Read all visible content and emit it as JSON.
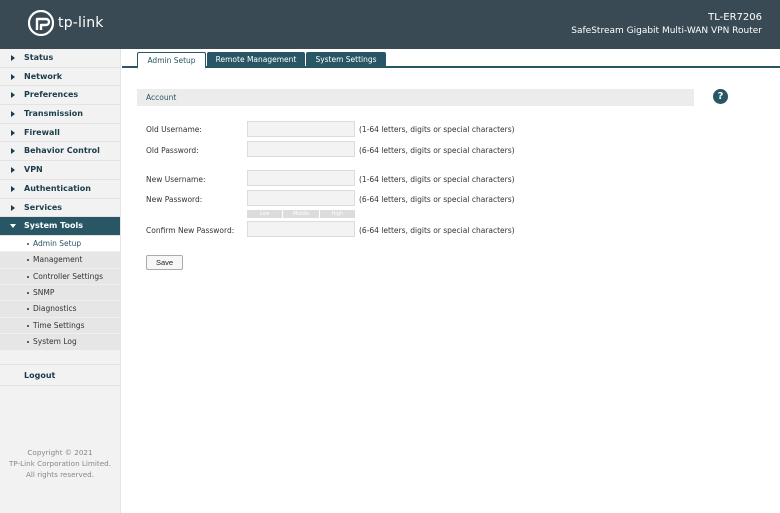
{
  "header": {
    "brand": "tp-link",
    "model": "TL-ER7206",
    "product": "SafeStream Gigabit Multi-WAN VPN Router"
  },
  "sidebar": {
    "items": [
      {
        "label": "Status"
      },
      {
        "label": "Network"
      },
      {
        "label": "Preferences"
      },
      {
        "label": "Transmission"
      },
      {
        "label": "Firewall"
      },
      {
        "label": "Behavior Control"
      },
      {
        "label": "VPN"
      },
      {
        "label": "Authentication"
      },
      {
        "label": "Services"
      },
      {
        "label": "System Tools"
      }
    ],
    "subitems": [
      {
        "label": "Admin Setup"
      },
      {
        "label": "Management"
      },
      {
        "label": "Controller Settings"
      },
      {
        "label": "SNMP"
      },
      {
        "label": "Diagnostics"
      },
      {
        "label": "Time Settings"
      },
      {
        "label": "System Log"
      }
    ],
    "logout": "Logout",
    "copyright": [
      "Copyright © 2021",
      "TP-Link Corporation Limited.",
      "All rights reserved."
    ]
  },
  "tabs": [
    {
      "label": "Admin Setup"
    },
    {
      "label": "Remote Management"
    },
    {
      "label": "System Settings"
    }
  ],
  "section": {
    "title": "Account",
    "help_icon": "?"
  },
  "form": {
    "old_username": {
      "label": "Old Username:",
      "value": "",
      "hint": "(1-64 letters, digits or special characters)"
    },
    "old_password": {
      "label": "Old Password:",
      "value": "",
      "hint": "(6-64 letters, digits or special characters)"
    },
    "new_username": {
      "label": "New Username:",
      "value": "",
      "hint": "(1-64 letters, digits or special characters)"
    },
    "new_password": {
      "label": "New Password:",
      "value": "",
      "hint": "(6-64 letters, digits or special characters)"
    },
    "strength": [
      "Low",
      "Middle",
      "High"
    ],
    "confirm_password": {
      "label": "Confirm New Password:",
      "value": "",
      "hint": "(6-64 letters, digits or special characters)"
    },
    "save_label": "Save"
  },
  "colors": {
    "header_bg": "#394a54",
    "accent": "#285665"
  }
}
